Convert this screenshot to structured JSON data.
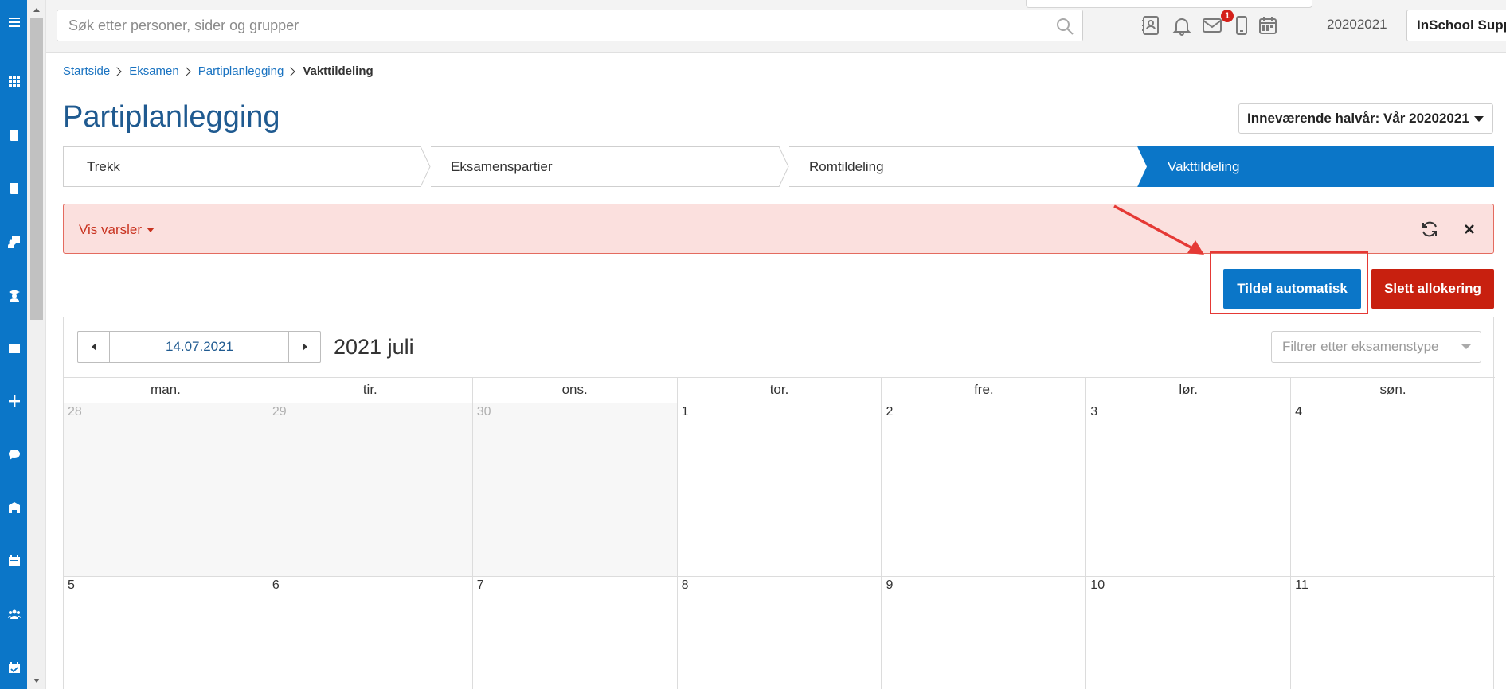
{
  "search": {
    "placeholder": "Søk etter personer, sider og grupper"
  },
  "header": {
    "notification_count": "1",
    "term": "20202021",
    "user": "InSchool Support"
  },
  "breadcrumb": [
    "Startside",
    "Eksamen",
    "Partiplanlegging",
    "Vakttildeling"
  ],
  "page_title": "Partiplanlegging",
  "semester_select": "Inneværende halvår: Vår 20202021",
  "steps": [
    "Trekk",
    "Eksamenspartier",
    "Romtildeling",
    "Vakttildeling"
  ],
  "active_step": "Vakttildeling",
  "alert": {
    "toggle_label": "Vis varsler"
  },
  "buttons": {
    "auto_assign": "Tildel automatisk",
    "delete_allocation": "Slett allokering"
  },
  "calendar": {
    "date_value": "14.07.2021",
    "title": "2021 juli",
    "filter_placeholder": "Filtrer etter eksamenstype",
    "weekdays": [
      "man.",
      "tir.",
      "ons.",
      "tor.",
      "fre.",
      "lør.",
      "søn."
    ],
    "weeks": [
      [
        "28",
        "29",
        "30",
        "1",
        "2",
        "3",
        "4"
      ],
      [
        "5",
        "6",
        "7",
        "8",
        "9",
        "10",
        "11"
      ]
    ],
    "outside_month_days": 3
  },
  "colors": {
    "brand_blue": "#0b76c8",
    "danger_red": "#c8200f",
    "alert_bg": "#fbe0de",
    "annotation_red": "#e53935"
  },
  "rail_icons": [
    "menu-icon",
    "apps-grid-icon",
    "book-icon",
    "book-icon",
    "teacher-icon",
    "graduate-icon",
    "briefcase-icon",
    "plus-icon",
    "chat-icon",
    "school-icon",
    "calendar-icon",
    "people-icon",
    "calendar-check-icon"
  ]
}
